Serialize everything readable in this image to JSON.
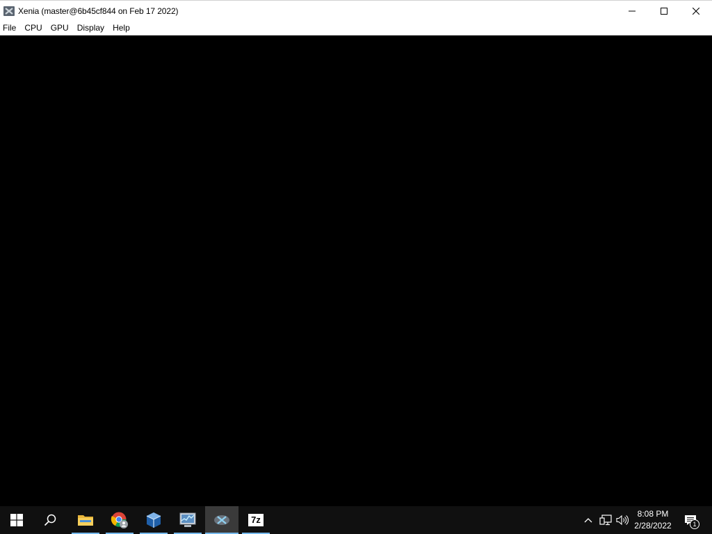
{
  "window": {
    "title": "Xenia (master@6b45cf844 on Feb 17 2022)",
    "icon": "xenia-icon",
    "caption_buttons": [
      "minimize-icon",
      "maximize-icon",
      "close-icon"
    ]
  },
  "menubar": {
    "items": [
      {
        "label": "File"
      },
      {
        "label": "CPU"
      },
      {
        "label": "GPU"
      },
      {
        "label": "Display"
      },
      {
        "label": "Help"
      }
    ]
  },
  "taskbar": {
    "background": "#101010",
    "accent": "#76b9ed",
    "buttons": [
      {
        "name": "start-button",
        "icon": "windows-logo-icon"
      },
      {
        "name": "search-button",
        "icon": "search-icon"
      },
      {
        "name": "file-explorer",
        "icon": "folder-icon",
        "running": true
      },
      {
        "name": "chrome",
        "icon": "chrome-icon",
        "running": true
      },
      {
        "name": "virtualbox",
        "icon": "virtualbox-icon",
        "running": true
      },
      {
        "name": "task-manager",
        "icon": "task-manager-icon",
        "running": true
      },
      {
        "name": "xenia",
        "icon": "xenia-icon",
        "running": true,
        "active": true
      },
      {
        "name": "7zip",
        "icon": "7zip-icon",
        "label": "7z",
        "running": true
      }
    ],
    "tray": {
      "icons": [
        "chevron-up-icon",
        "network-icon",
        "volume-icon"
      ],
      "time": "8:08 PM",
      "date": "2/28/2022",
      "notification_count": "1"
    }
  }
}
